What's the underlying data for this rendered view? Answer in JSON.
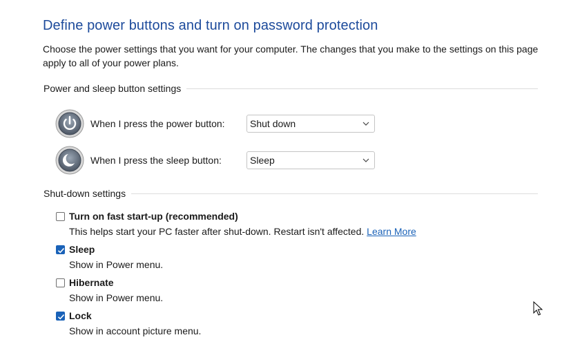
{
  "page": {
    "title": "Define power buttons and turn on password protection",
    "intro": "Choose the power settings that you want for your computer. The changes that you make to the settings on this page apply to all of your power plans."
  },
  "power_sleep": {
    "header": "Power and sleep button settings",
    "power_button": {
      "label": "When I press the power button:",
      "value": "Shut down",
      "icon": "power-icon"
    },
    "sleep_button": {
      "label": "When I press the sleep button:",
      "value": "Sleep",
      "icon": "sleep-icon"
    }
  },
  "shutdown": {
    "header": "Shut-down settings",
    "items": [
      {
        "label": "Turn on fast start-up (recommended)",
        "checked": false,
        "desc": "This helps start your PC faster after shut-down. Restart isn't affected.",
        "link": "Learn More"
      },
      {
        "label": "Sleep",
        "checked": true,
        "desc": "Show in Power menu."
      },
      {
        "label": "Hibernate",
        "checked": false,
        "desc": "Show in Power menu."
      },
      {
        "label": "Lock",
        "checked": true,
        "desc": "Show in account picture menu."
      }
    ]
  },
  "colors": {
    "title": "#1c4a9b",
    "accent": "#1a62b8"
  }
}
